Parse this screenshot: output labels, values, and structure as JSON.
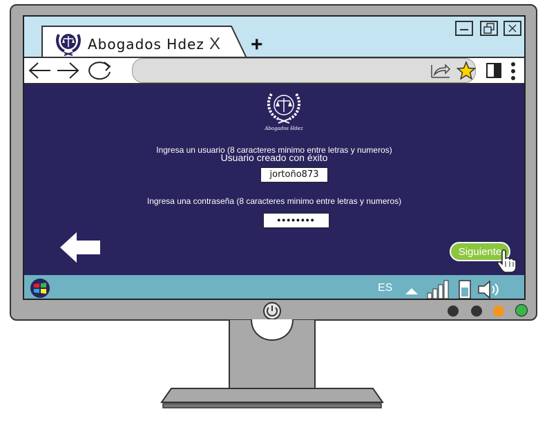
{
  "browser": {
    "tab_title": "Abogados  Hdez",
    "tab_close": "X",
    "new_tab": "+"
  },
  "page": {
    "logo_caption": "Abogados Hdez",
    "username_prompt": "Ingresa un usuario (8 caracteres minimo entre letras y numeros)",
    "success_message": "Usuario creado con éxito",
    "username_value": "jortoño873",
    "password_prompt": "Ingresa una contraseña (8 caracteres minimo entre letras y numeros)",
    "password_value": "••••••••",
    "next_label": "Siguiente"
  },
  "taskbar": {
    "language": "ES"
  },
  "colors": {
    "page_bg": "#29245e",
    "titlebar": "#c4e4f2",
    "taskbar": "#6fb2c2",
    "next_button": "#8cc63f",
    "bezel": "#a9a9a9",
    "led_orange": "#f7941d",
    "led_green": "#39b54a"
  },
  "icons": [
    "scales-of-justice-logo",
    "back-arrow",
    "forward-arrow",
    "reload",
    "share",
    "favorite-star",
    "sidebar",
    "menu-dots",
    "minimize",
    "restore",
    "close",
    "windows-start",
    "up-caret",
    "signal-bars",
    "battery",
    "speaker",
    "pointer-hand",
    "power"
  ]
}
